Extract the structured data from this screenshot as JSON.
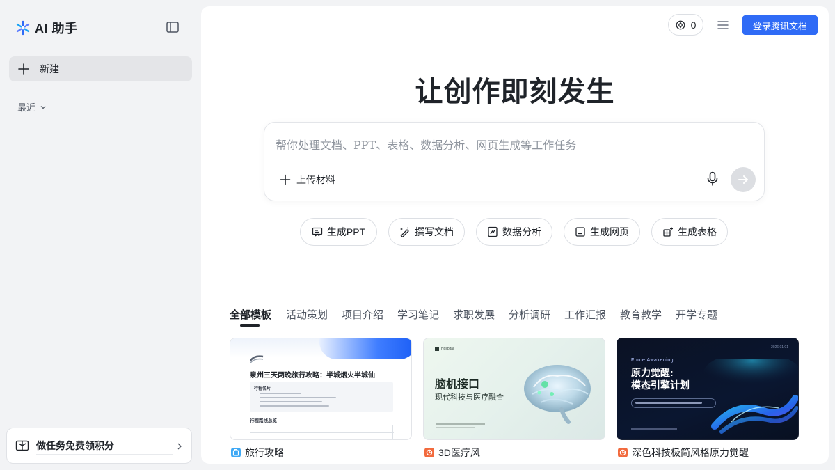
{
  "sidebar": {
    "logo_text": "AI 助手",
    "new_label": "新建",
    "recent_label": "最近",
    "task_label": "做任务免费领积分"
  },
  "header": {
    "points": "0",
    "login_label": "登录腾讯文档"
  },
  "hero": {
    "title": "让创作即刻发生"
  },
  "prompt": {
    "placeholder": "帮你处理文档、PPT、表格、数据分析、网页生成等工作任务",
    "upload_label": "上传材料"
  },
  "quick_actions": [
    {
      "label": "生成PPT",
      "icon": "presentation-icon"
    },
    {
      "label": "撰写文档",
      "icon": "magic-pen-icon"
    },
    {
      "label": "数据分析",
      "icon": "chart-icon"
    },
    {
      "label": "生成网页",
      "icon": "webpage-icon"
    },
    {
      "label": "生成表格",
      "icon": "table-icon"
    }
  ],
  "tabs": [
    "全部模板",
    "活动策划",
    "项目介绍",
    "学习笔记",
    "求职发展",
    "分析调研",
    "工作汇报",
    "教育教学",
    "开学专题"
  ],
  "templates": [
    {
      "caption": "旅行攻略",
      "caption_icon_color": "#3fa9f5",
      "thumb": {
        "title": "泉州三天两晚旅行攻略：半城烟火半城仙",
        "section1": "行程名片",
        "section2": "行程路线总览"
      }
    },
    {
      "caption": "3D医疗风",
      "caption_icon_color": "#f26a3d",
      "thumb": {
        "brand": "Hospital",
        "title": "脑机接口",
        "subtitle": "现代科技与医疗融合"
      }
    },
    {
      "caption": "深色科技极简风格原力觉醒",
      "caption_icon_color": "#f26a3d",
      "thumb": {
        "kicker": "Force Awakening",
        "title_line1": "原力觉醒:",
        "title_line2": "模态引擎计划",
        "date": "2026.01.01"
      }
    }
  ],
  "colors": {
    "accent": "#2f6bf6",
    "text": "#1f2329",
    "muted": "#8f959e"
  }
}
